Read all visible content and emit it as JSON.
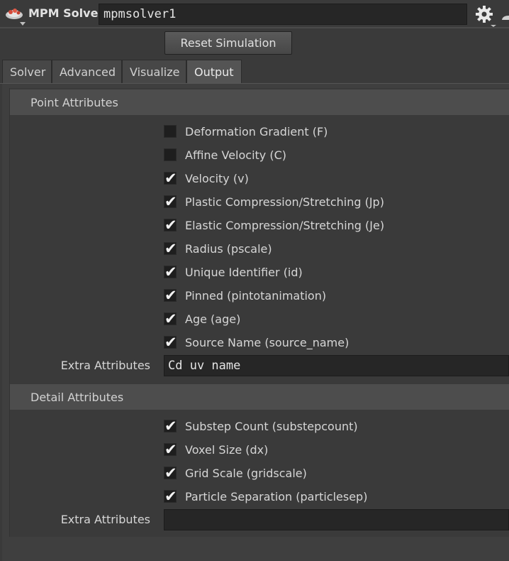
{
  "header": {
    "node_type": "MPM Solver",
    "node_name": "mpmsolver1",
    "node_icon": "mpm-solver-node-icon",
    "gear_icon": "gear-icon"
  },
  "actions": {
    "reset_label": "Reset Simulation"
  },
  "tabs": [
    {
      "label": "Solver",
      "active": false
    },
    {
      "label": "Advanced",
      "active": false
    },
    {
      "label": "Visualize",
      "active": false
    },
    {
      "label": "Output",
      "active": true
    }
  ],
  "point_attributes": {
    "title": "Point Attributes",
    "items": [
      {
        "label": "Deformation Gradient (F)",
        "checked": false
      },
      {
        "label": "Affine Velocity (C)",
        "checked": false
      },
      {
        "label": "Velocity (v)",
        "checked": true
      },
      {
        "label": "Plastic Compression/Stretching (Jp)",
        "checked": true
      },
      {
        "label": "Elastic Compression/Stretching (Je)",
        "checked": true
      },
      {
        "label": "Radius (pscale)",
        "checked": true
      },
      {
        "label": "Unique Identifier (id)",
        "checked": true
      },
      {
        "label": "Pinned (pintotanimation)",
        "checked": true
      },
      {
        "label": "Age (age)",
        "checked": true
      },
      {
        "label": "Source Name (source_name)",
        "checked": true
      }
    ],
    "extra_label": "Extra Attributes",
    "extra_value": "Cd uv name"
  },
  "detail_attributes": {
    "title": "Detail Attributes",
    "items": [
      {
        "label": "Substep Count (substepcount)",
        "checked": true
      },
      {
        "label": "Voxel Size (dx)",
        "checked": true
      },
      {
        "label": "Grid Scale (gridscale)",
        "checked": true
      },
      {
        "label": "Particle Separation (particlesep)",
        "checked": true
      }
    ],
    "extra_label": "Extra Attributes",
    "extra_value": ""
  },
  "colors": {
    "background": "#3a3a3a",
    "section_header": "#4d4d4d",
    "field": "#262626",
    "text": "#d6d6d6"
  }
}
